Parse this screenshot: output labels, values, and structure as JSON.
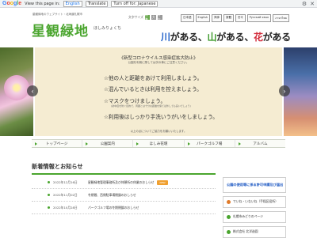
{
  "translate_bar": {
    "logo_letters": [
      "G",
      "o",
      "o",
      "g",
      "l",
      "e"
    ],
    "view_label": "View this page in:",
    "language_value": "English",
    "translate_button": "Translate",
    "turn_off_label": "Turn off for: Japanese",
    "gear_icon": "gear-icon",
    "close_icon": "close-icon"
  },
  "header": {
    "tagline": "星観緑地のウェブサイト・北海道札幌市",
    "logo": "星観緑地",
    "logo_kana": "ほしみりょくち",
    "slogan": {
      "k": "川",
      "p1": "がある、",
      "y": "山",
      "p2": "がある、",
      "h": "花",
      "p3": "がある"
    },
    "font_size_label": "文字サイズ",
    "font_buttons": [
      "標準",
      "大",
      "特大"
    ],
    "languages": [
      "日本語",
      "English",
      "简体",
      "繁體",
      "한국",
      "Русский язык",
      "ภาษาไทย"
    ]
  },
  "slider": {
    "notice_title": "《新型コロナウイルス感染症拡大防止》",
    "notice_sub": "公園を利用に際しては次の事にご注意ください。",
    "lines": [
      "☆他の人と距離をあけて利用しましょう。",
      "☆混んでいるときは利用を控えましょう。",
      "☆マスクをつけましょう。",
      "☆利用後はしっかり手洗いうがいをしましょう。"
    ],
    "mask_note": "(熱中症を防ぐ目的で、周囲とは十分な距離を保てば外しても良いでしょう)",
    "footer": "以上の点についてご協力をお願いいたします。",
    "dot_count": 4,
    "active_dot": 0
  },
  "nav": [
    "トップページ",
    "公園案内",
    "ほしみ花壇",
    "パークゴルフ場",
    "アルバム"
  ],
  "news": {
    "heading": "新着情報とお知らせ",
    "items": [
      {
        "date": "2022年12月16日",
        "title": "星観緑地管理事務所及び休憩所の休業のおしらせ",
        "badge": "NEW"
      },
      {
        "date": "2022年11月02日",
        "title": "冬期間、西側駐車場閉鎖のおしらせ",
        "badge": ""
      },
      {
        "date": "2022年10月28日",
        "title": "パークゴルフ場の冬期閉鎖のおしらせ",
        "badge": ""
      }
    ]
  },
  "banners": [
    {
      "label": "公園の使用等に係る許可申請及び届出",
      "style": "blue",
      "icon_color": ""
    },
    {
      "label": "でいね・いないね（手稲区役所）",
      "style": "plain",
      "icon_color": "#e07b2a"
    },
    {
      "label": "札幌市みどりのページ",
      "style": "plain",
      "icon_color": "#4aa52e"
    },
    {
      "label": "株式会社 北洋造園",
      "style": "plain",
      "icon_color": "#4aa52e"
    }
  ]
}
